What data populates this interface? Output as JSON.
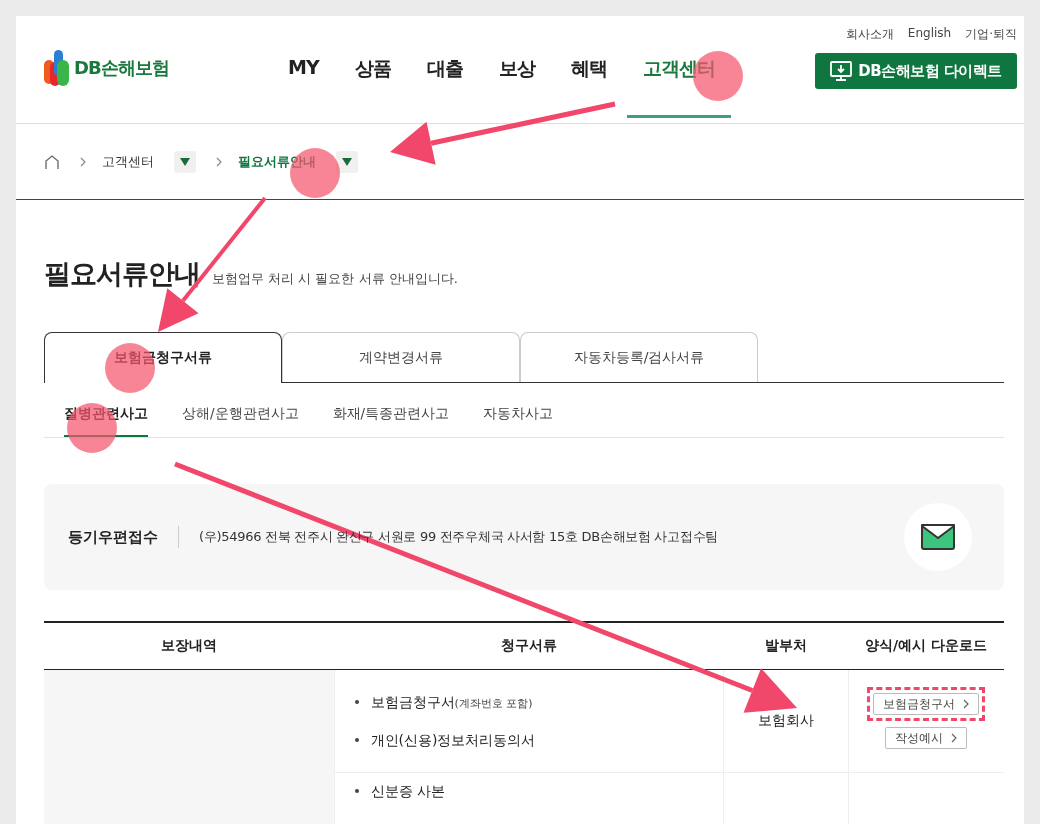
{
  "top_links": [
    {
      "label": "회사소개"
    },
    {
      "label": "English"
    },
    {
      "label": "기업·퇴직"
    }
  ],
  "logo": {
    "text": "DB손해보험"
  },
  "nav": [
    {
      "label": "MY",
      "selected": false
    },
    {
      "label": "상품",
      "selected": false
    },
    {
      "label": "대출",
      "selected": false
    },
    {
      "label": "보상",
      "selected": false
    },
    {
      "label": "혜택",
      "selected": false
    },
    {
      "label": "고객센터",
      "selected": true
    }
  ],
  "direct_button": {
    "label": "DB손해보험 다이렉트"
  },
  "breadcrumb": [
    {
      "label": "고객센터",
      "current": false
    },
    {
      "label": "필요서류안내",
      "current": true
    }
  ],
  "page_title": "필요서류안내",
  "page_subtitle": "보험업무 처리 시 필요한 서류 안내입니다.",
  "tabs": [
    {
      "label": "보험금청구서류",
      "selected": true
    },
    {
      "label": "계약변경서류",
      "selected": false
    },
    {
      "label": "자동차등록/검사서류",
      "selected": false
    }
  ],
  "subtabs": [
    {
      "label": "질병관련사고",
      "selected": true
    },
    {
      "label": "상해/운행관련사고",
      "selected": false
    },
    {
      "label": "화재/특종관련사고",
      "selected": false
    },
    {
      "label": "자동차사고",
      "selected": false
    }
  ],
  "mail_box": {
    "label": "등기우편접수",
    "address": "(우)54966 전북 전주시 완산구 서원로 99 전주우체국 사서함 15호 DB손해보험 사고접수팀"
  },
  "table": {
    "columns": [
      "보장내역",
      "청구서류",
      "발부처",
      "양식/예시 다운로드"
    ],
    "rows": [
      {
        "documents": [
          {
            "name": "보험금청구서",
            "note": "(계좌번호 포함)"
          },
          {
            "name": "개인(신용)정보처리동의서"
          }
        ],
        "issuer": "보험회사",
        "downloads": [
          {
            "label": "보험금청구서",
            "highlighted": true
          },
          {
            "label": "작성예시",
            "highlighted": false
          }
        ]
      },
      {
        "documents": [
          {
            "name": "신분증 사본"
          }
        ]
      }
    ]
  }
}
